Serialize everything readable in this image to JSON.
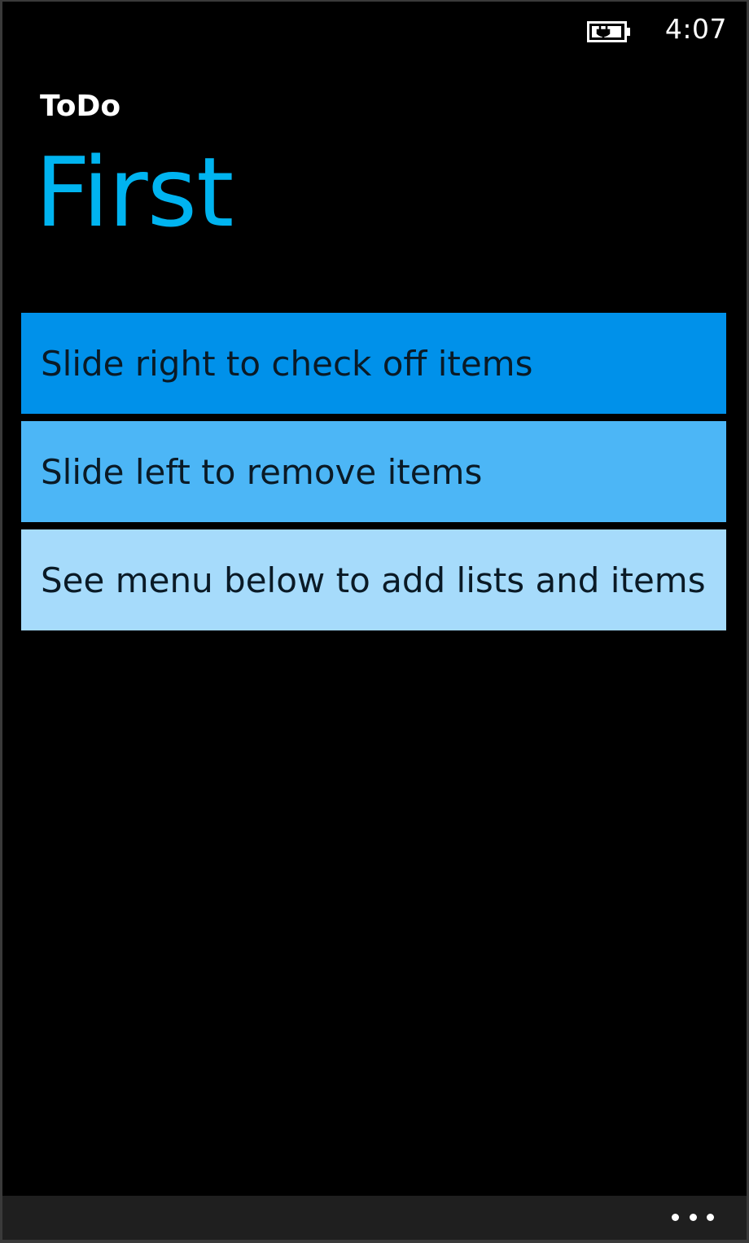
{
  "status_bar": {
    "battery_icon": "battery-charging-icon",
    "time": "4:07"
  },
  "header": {
    "app_title": "ToDo",
    "page_title": "First"
  },
  "list": {
    "items": [
      {
        "text": "Slide right to check off items",
        "color": "#0091ea"
      },
      {
        "text": "Slide left to remove items",
        "color": "#4cb6f6"
      },
      {
        "text": "See menu below to add lists and items",
        "color": "#a6dbfb"
      }
    ]
  },
  "app_bar": {
    "more_icon": "more-dots-icon",
    "background": "#1f1f1f"
  },
  "colors": {
    "accent": "#00b4f0",
    "background": "#000000"
  }
}
